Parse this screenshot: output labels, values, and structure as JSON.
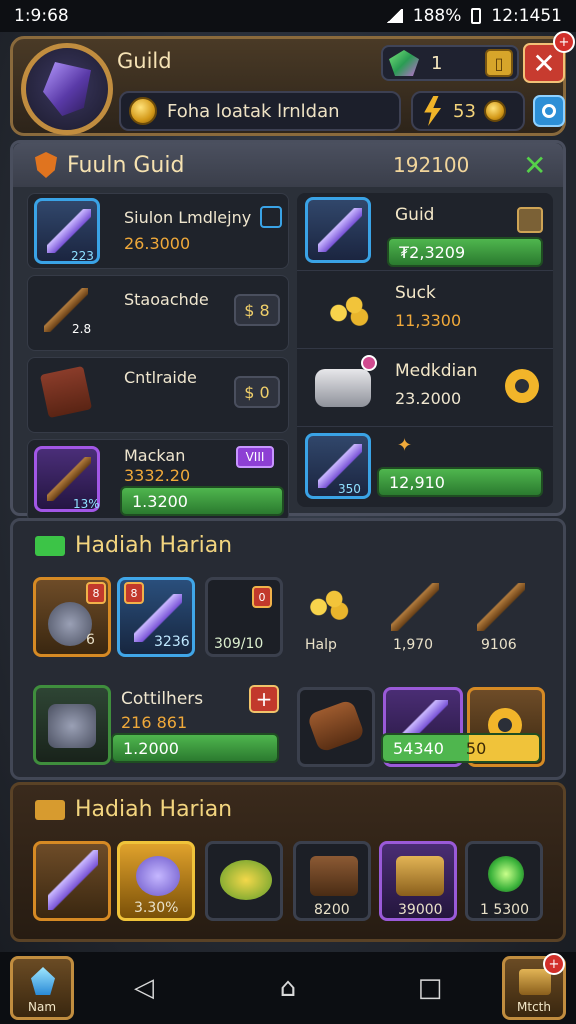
{
  "status_bar": {
    "time_left": "1:9:68",
    "battery": "188%",
    "time_right": "12:1451"
  },
  "header": {
    "title": "Guild",
    "gem_count": "1",
    "close_label": "✕",
    "close_badge": "+",
    "name_field": "Foha loatak lrnldan",
    "gold_count": "53"
  },
  "guild": {
    "title": "Fuuln Guid",
    "count": "192100",
    "left_rows": [
      {
        "title": "Siulon Lmdlejny",
        "sub": "26.3000",
        "chip": "223"
      },
      {
        "title": "Staoachde",
        "sub": "",
        "button": "$ 8",
        "chip": "2.8"
      },
      {
        "title": "Cntlraide",
        "sub": "",
        "button": "$ 0"
      },
      {
        "title": "Mackan",
        "sub": "3332.20",
        "bar": "1.3200",
        "tag": "VIII",
        "chip": "13%"
      }
    ],
    "right_rows": [
      {
        "title": "Guid",
        "bar": "₮2,3209"
      },
      {
        "title": "Suck",
        "sub": "11,3300"
      },
      {
        "title": "Medkdian",
        "sub": "23.2000"
      },
      {
        "title": "",
        "bar": "12,910",
        "chip": "350"
      }
    ]
  },
  "daily": {
    "title": "Hadiah Harian",
    "row1": [
      {
        "label": "",
        "badge": "8",
        "corner": "6"
      },
      {
        "label": "3236",
        "badge": "8"
      },
      {
        "label": "309/10",
        "badge": "0"
      },
      {
        "label": "Halp"
      },
      {
        "label": "1,970"
      },
      {
        "label": "9106"
      }
    ],
    "row2_title": "Cottilhers",
    "row2_sub": "216 861",
    "row2_bar": "1.2000",
    "row2_plus": "+",
    "row2_bar2": "54340",
    "row2_bar2_b": "50"
  },
  "daily2": {
    "title": "Hadiah Harian",
    "slots": [
      {
        "label": ""
      },
      {
        "label": "3.30%"
      },
      {
        "label": ""
      },
      {
        "label": "8200"
      },
      {
        "label": "39000"
      },
      {
        "label": "1 5300"
      }
    ]
  },
  "navbar": {
    "left_label": "Nam",
    "right_label": "Mtcth",
    "right_badge": "+"
  }
}
